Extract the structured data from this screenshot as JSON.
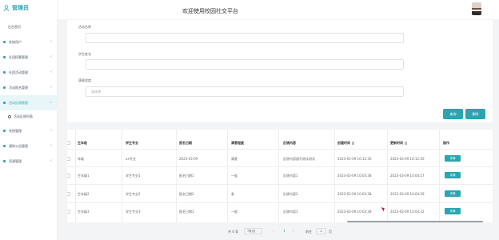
{
  "brand": {
    "title": "管理员"
  },
  "header": {
    "title": "欢迎使用校园社交平台"
  },
  "sidebar": {
    "home": "后台首页",
    "items": [
      {
        "label": "系统用户"
      },
      {
        "label": "社团招募管理"
      },
      {
        "label": "社团活动管理"
      },
      {
        "label": "活动报名管理"
      },
      {
        "label": "活动反馈管理"
      },
      {
        "label": "活动反馈列表"
      },
      {
        "label": "系统管理"
      },
      {
        "label": "通知公告管理"
      },
      {
        "label": "资源管理"
      }
    ]
  },
  "form": {
    "activity_name_label": "活动名称",
    "student_name_label": "学生姓名",
    "satisfaction_label": "满意程度",
    "satisfaction_placeholder": "请选择",
    "search_button": "查询",
    "delete_button": "删除"
  },
  "table": {
    "headers": [
      "生年级",
      "学生专业",
      "报名日期",
      "满意程度",
      "反馈内容",
      "创建时间",
      "更新时间",
      "操作"
    ],
    "detail_label": "详情",
    "rows": [
      [
        "年级",
        "xx专业",
        "2023-03-09",
        "满意",
        "反馈内容描写测试测试",
        "2023-03-09 10:12:30",
        "2023-03-09 10:12:30"
      ],
      [
        "生年级1",
        "学生专业1",
        "报名日期1",
        "一般",
        "反馈内容1",
        "2023-03-09 10:03:38",
        "2023-03-09 10:04:27"
      ],
      [
        "生年级2",
        "学生专业2",
        "报名日期2",
        "差",
        "反馈内容2",
        "2023-03-09 10:03:38",
        "2023-03-09 10:04:29"
      ],
      [
        "生年级3",
        "学生专业3",
        "报名日期3",
        "一般",
        "反馈内容3",
        "2023-03-09 10:03:38",
        "2023-03-09 10:04:32"
      ]
    ]
  },
  "pager": {
    "total": "共 4 条",
    "page_size": "7条/页",
    "prev": "‹",
    "current": "1",
    "next": "›",
    "goto_label": "前往",
    "goto_value": "1",
    "page_unit": "页"
  },
  "colors": {
    "accent": "#2aa6b0"
  }
}
